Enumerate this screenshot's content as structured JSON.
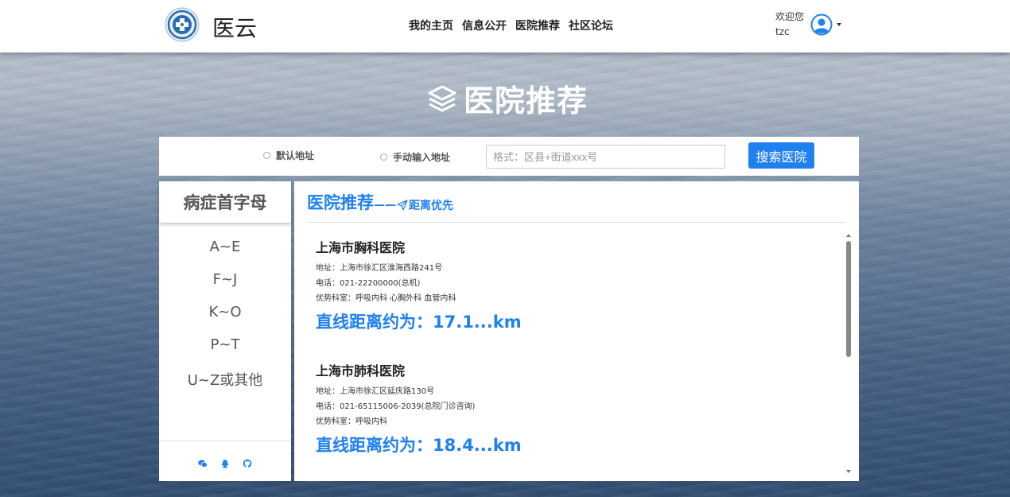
{
  "brand": {
    "logo": "medical-cross-logo",
    "name": "医云"
  },
  "nav": {
    "links": [
      "我的主页",
      "信息公开",
      "医院推荐",
      "社区论坛"
    ]
  },
  "user": {
    "welcome": "欢迎您",
    "username": "tzc",
    "icon": "user-circle-icon"
  },
  "hero": {
    "icon": "layers-icon",
    "title": "医院推荐"
  },
  "search": {
    "option_default": "默认地址",
    "option_manual": "手动输入地址",
    "placeholder": "格式：区县+街道xxx号",
    "value": "",
    "button_label": "搜索医院"
  },
  "sidebar": {
    "header": "病症首字母",
    "letters": [
      "A~E",
      "F~J",
      "K~O",
      "P~T",
      "U~Z或其他"
    ],
    "footer_icons": [
      "wechat-icon",
      "qq-icon",
      "github-icon"
    ]
  },
  "main": {
    "title": "医院推荐",
    "subtitle_prefix": "——",
    "subtitle": "距离优先",
    "hospitals": [
      {
        "name": "上海市胸科医院",
        "address": "地址：上海市徐汇区淮海西路241号",
        "phone": "电话：021-22200000(总机)",
        "departments": "优势科室：呼吸内科 心胸外科 血管内科",
        "distance": "直线距离约为：17.1...km"
      },
      {
        "name": "上海市肺科医院",
        "address": "地址：上海市徐汇区延庆路130号",
        "phone": "电话：021-65115006-2039(总院门诊咨询)",
        "departments": "优势科室：呼吸内科",
        "distance": "直线距离约为：18.4...km"
      }
    ]
  },
  "colors": {
    "accent": "#1f80f0",
    "header_bg": "#ffffff",
    "panel_bg": "#ffffff"
  }
}
